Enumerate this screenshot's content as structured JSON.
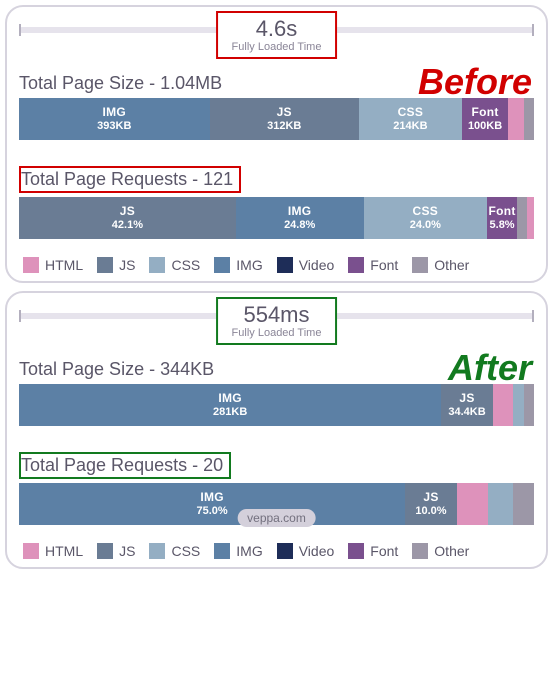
{
  "watermark": "veppa.com",
  "chart_data": [
    {
      "type": "bar",
      "title": "Before — Total Page Size",
      "load_time": "4.6s",
      "load_time_label": "Fully Loaded Time",
      "total_label": "Total Page Size - 1.04MB",
      "unit": "KB",
      "segments": [
        {
          "name": "IMG",
          "value_kb": 393,
          "label": "393KB",
          "pct": 37
        },
        {
          "name": "JS",
          "value_kb": 312,
          "label": "312KB",
          "pct": 29
        },
        {
          "name": "CSS",
          "value_kb": 214,
          "label": "214KB",
          "pct": 20
        },
        {
          "name": "Font",
          "value_kb": 100,
          "label": "100KB",
          "pct": 9
        },
        {
          "name": "HTML",
          "value_kb": null,
          "label": "",
          "pct": 3
        },
        {
          "name": "Other",
          "value_kb": null,
          "label": "",
          "pct": 2
        }
      ]
    },
    {
      "type": "bar",
      "title": "Before — Total Page Requests",
      "total_label": "Total Page Requests - 121",
      "unit": "%",
      "segments": [
        {
          "name": "JS",
          "pct": 42.1,
          "label": "42.1%"
        },
        {
          "name": "IMG",
          "pct": 24.8,
          "label": "24.8%"
        },
        {
          "name": "CSS",
          "pct": 24.0,
          "label": "24.0%"
        },
        {
          "name": "Font",
          "pct": 5.8,
          "label": "5.8%"
        },
        {
          "name": "Other",
          "pct": 2.0,
          "label": ""
        },
        {
          "name": "HTML",
          "pct": 1.3,
          "label": ""
        }
      ]
    },
    {
      "type": "bar",
      "title": "After — Total Page Size",
      "load_time": "554ms",
      "load_time_label": "Fully Loaded Time",
      "total_label": "Total Page Size - 344KB",
      "unit": "KB",
      "segments": [
        {
          "name": "IMG",
          "value_kb": 281,
          "label": "281KB",
          "pct": 82
        },
        {
          "name": "JS",
          "value_kb": 34.4,
          "label": "34.4KB",
          "pct": 10
        },
        {
          "name": "HTML",
          "value_kb": null,
          "label": "",
          "pct": 4
        },
        {
          "name": "CSS",
          "value_kb": null,
          "label": "",
          "pct": 2
        },
        {
          "name": "Other",
          "value_kb": null,
          "label": "",
          "pct": 2
        }
      ]
    },
    {
      "type": "bar",
      "title": "After — Total Page Requests",
      "total_label": "Total Page Requests - 20",
      "unit": "%",
      "segments": [
        {
          "name": "IMG",
          "pct": 75.0,
          "label": "75.0%"
        },
        {
          "name": "JS",
          "pct": 10.0,
          "label": "10.0%"
        },
        {
          "name": "HTML",
          "pct": 6.0,
          "label": ""
        },
        {
          "name": "CSS",
          "pct": 5.0,
          "label": ""
        },
        {
          "name": "Other",
          "pct": 4.0,
          "label": ""
        }
      ]
    }
  ],
  "legend": [
    "HTML",
    "JS",
    "CSS",
    "IMG",
    "Video",
    "Font",
    "Other"
  ],
  "tag_before": "Before",
  "tag_after": "After"
}
